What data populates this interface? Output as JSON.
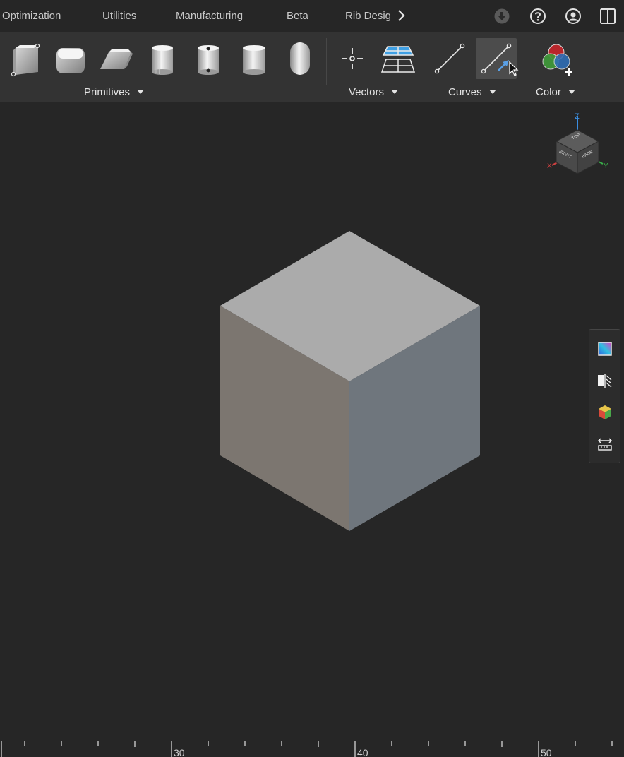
{
  "tabs": [
    {
      "label": "Optimization"
    },
    {
      "label": "Utilities"
    },
    {
      "label": "Manufacturing"
    },
    {
      "label": "Beta"
    },
    {
      "label": "Rib Desig"
    }
  ],
  "top_icons": [
    "download-icon",
    "help-icon",
    "user-icon",
    "panel-toggle-icon"
  ],
  "ribbon": {
    "groups": [
      {
        "label": "Primitives",
        "items": [
          "box",
          "rounded-box",
          "parallelepiped",
          "cylinder",
          "hollow-cylinder",
          "straight-cylinder",
          "capsule"
        ]
      },
      {
        "label": "Vectors",
        "items": [
          "point",
          "plane"
        ]
      },
      {
        "label": "Curves",
        "items": [
          "line",
          "tangent-line"
        ],
        "active": "tangent-line"
      },
      {
        "label": "Color",
        "items": [
          "color-add"
        ]
      }
    ]
  },
  "view_cube": {
    "faces": [
      "TOP",
      "RIGHT",
      "BACK"
    ],
    "axes": [
      "Z",
      "X",
      "Y"
    ]
  },
  "side_toolbar": [
    "gradient-icon",
    "section-icon",
    "color-cube-icon",
    "measure-icon"
  ],
  "ruler": {
    "labels": [
      "30",
      "40",
      "50"
    ]
  },
  "colors": {
    "background": "#262626",
    "ribbon": "#333333",
    "cube_top": "#ababab",
    "cube_left": "#7c7670",
    "cube_right": "#6f767d"
  }
}
